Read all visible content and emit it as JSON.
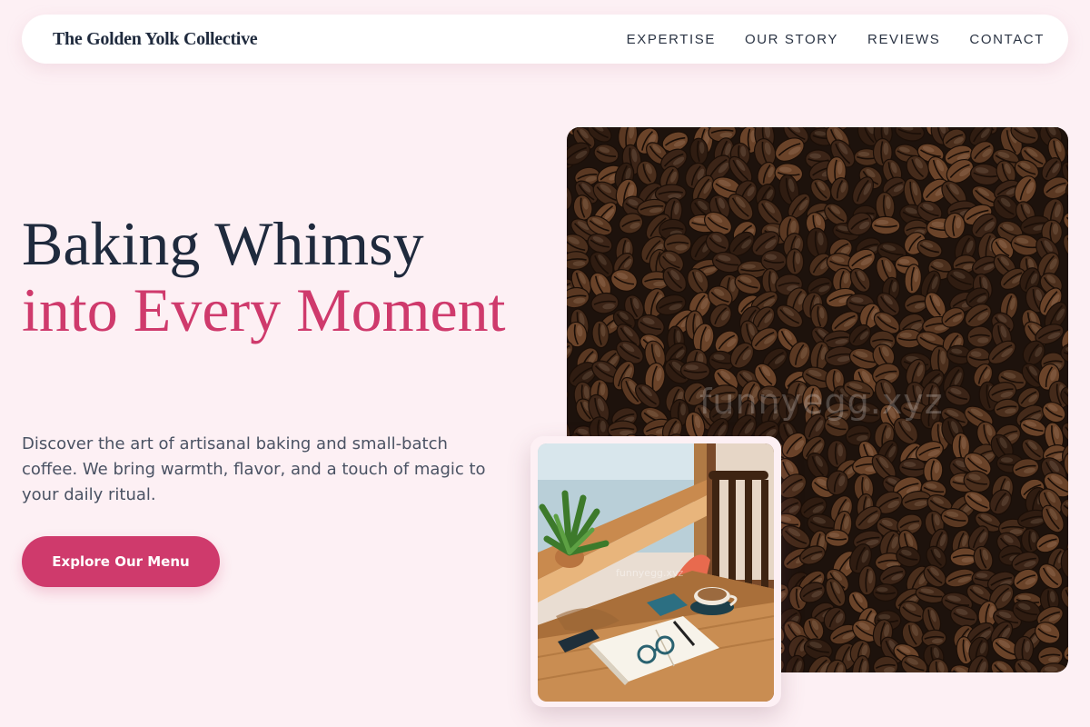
{
  "brand": {
    "name": "The Golden Yolk Collective"
  },
  "nav": {
    "links": [
      "EXPERTISE",
      "OUR STORY",
      "REVIEWS",
      "CONTACT"
    ]
  },
  "hero": {
    "title_line1": "Baking Whimsy",
    "title_line2": "into Every Moment",
    "description": "Discover the art of artisanal baking and small-batch coffee. We bring warmth, flavor, and a touch of magic to your daily ritual.",
    "cta_label": "Explore Our Menu"
  },
  "images": {
    "beans_watermark": "funnyegg.xyz",
    "cafe_watermark": "funnyegg.xyz"
  },
  "colors": {
    "background": "#fdf0f4",
    "accent": "#cf3a6c",
    "text_dark": "#1f2a3d",
    "text_muted": "#4a5263"
  }
}
